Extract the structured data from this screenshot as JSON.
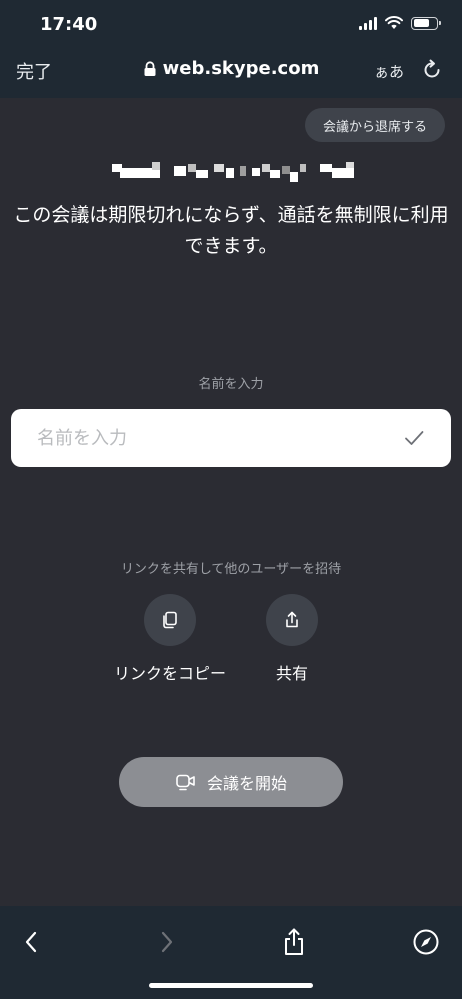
{
  "status_bar": {
    "time": "17:40"
  },
  "browser": {
    "done_label": "完了",
    "url": "web.skype.com",
    "text_size_label": "ぁあ"
  },
  "meeting": {
    "leave_label": "会議から退席する",
    "description": "この会議は期限切れにならず、通話を無制限に利用できます。",
    "name_label": "名前を入力",
    "name_value": "",
    "name_placeholder": "名前を入力",
    "invite_label": "リンクを共有して他のユーザーを招待",
    "copy_link_label": "リンクをコピー",
    "share_label": "共有",
    "start_label": "会議を開始"
  },
  "icons": {
    "lock": "lock-icon",
    "reload": "reload-icon",
    "check": "check-icon",
    "copy": "copy-icon",
    "share": "share-icon",
    "camera": "video-camera-icon",
    "back": "back-arrow-icon",
    "forward": "forward-arrow-icon",
    "toolbar_share": "share-icon",
    "compass": "compass-icon"
  },
  "colors": {
    "background": "#2b2c33",
    "chrome": "#1f2933",
    "button_dark": "#3f434b",
    "button_disabled": "#8c8e93",
    "muted_text": "#9ea1a7"
  }
}
